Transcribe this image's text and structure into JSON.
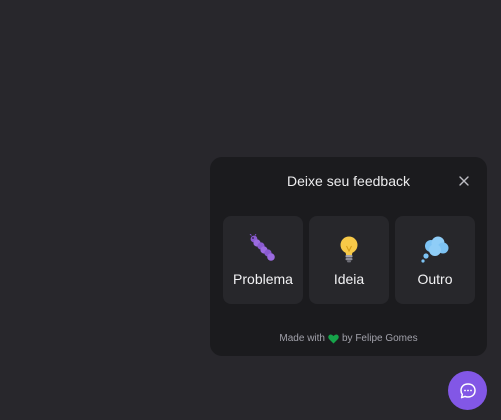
{
  "widget": {
    "title": "Deixe seu feedback",
    "close_icon": "close-icon",
    "options": [
      {
        "label": "Problema",
        "icon": "bug-icon"
      },
      {
        "label": "Ideia",
        "icon": "lightbulb-icon"
      },
      {
        "label": "Outro",
        "icon": "thought-cloud-icon"
      }
    ],
    "footer": {
      "made_with": "Made with",
      "by": "by Felipe Gomes",
      "heart_color": "#16a34a"
    }
  },
  "launcher": {
    "icon": "chat-bubble-icon",
    "color": "#8257e6"
  },
  "colors": {
    "background": "#28272c",
    "widget_background": "#1b1b1e",
    "option_background": "#27272b"
  }
}
